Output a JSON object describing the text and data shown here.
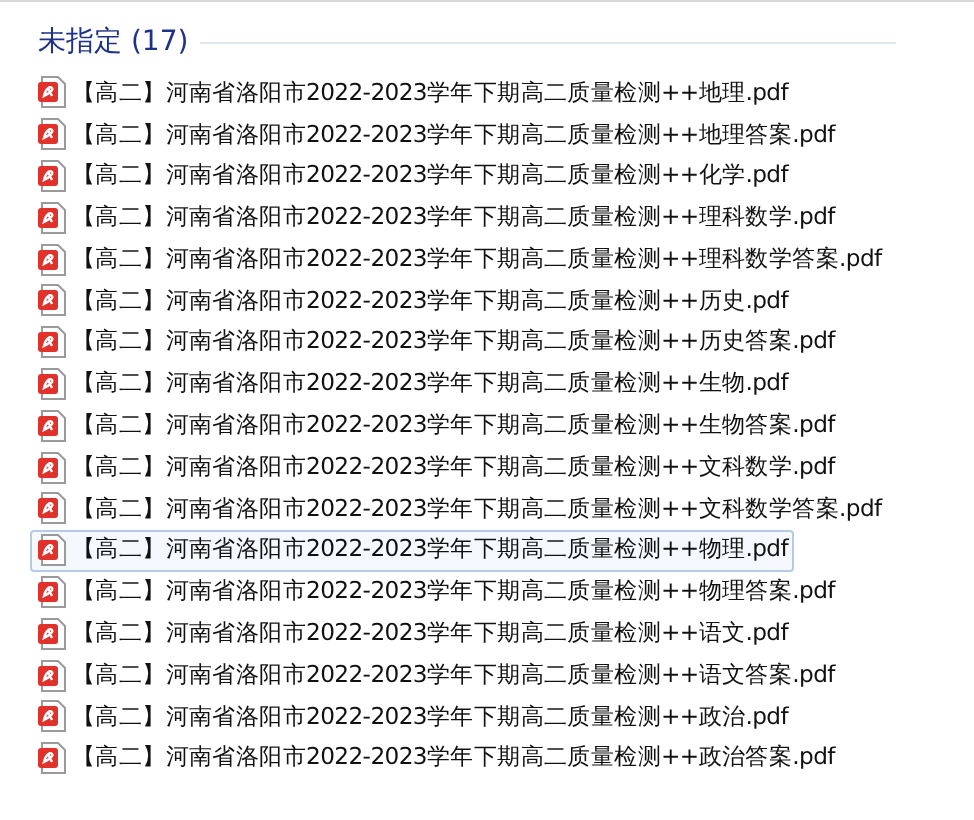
{
  "group": {
    "title": "未指定 (17)"
  },
  "files": [
    {
      "name": "【高二】河南省洛阳市2022-2023学年下期高二质量检测++地理.pdf",
      "selected": false
    },
    {
      "name": "【高二】河南省洛阳市2022-2023学年下期高二质量检测++地理答案.pdf",
      "selected": false
    },
    {
      "name": "【高二】河南省洛阳市2022-2023学年下期高二质量检测++化学.pdf",
      "selected": false
    },
    {
      "name": "【高二】河南省洛阳市2022-2023学年下期高二质量检测++理科数学.pdf",
      "selected": false
    },
    {
      "name": "【高二】河南省洛阳市2022-2023学年下期高二质量检测++理科数学答案.pdf",
      "selected": false
    },
    {
      "name": "【高二】河南省洛阳市2022-2023学年下期高二质量检测++历史.pdf",
      "selected": false
    },
    {
      "name": "【高二】河南省洛阳市2022-2023学年下期高二质量检测++历史答案.pdf",
      "selected": false
    },
    {
      "name": "【高二】河南省洛阳市2022-2023学年下期高二质量检测++生物.pdf",
      "selected": false
    },
    {
      "name": "【高二】河南省洛阳市2022-2023学年下期高二质量检测++生物答案.pdf",
      "selected": false
    },
    {
      "name": "【高二】河南省洛阳市2022-2023学年下期高二质量检测++文科数学.pdf",
      "selected": false
    },
    {
      "name": "【高二】河南省洛阳市2022-2023学年下期高二质量检测++文科数学答案.pdf",
      "selected": false
    },
    {
      "name": "【高二】河南省洛阳市2022-2023学年下期高二质量检测++物理.pdf",
      "selected": true
    },
    {
      "name": "【高二】河南省洛阳市2022-2023学年下期高二质量检测++物理答案.pdf",
      "selected": false
    },
    {
      "name": "【高二】河南省洛阳市2022-2023学年下期高二质量检测++语文.pdf",
      "selected": false
    },
    {
      "name": "【高二】河南省洛阳市2022-2023学年下期高二质量检测++语文答案.pdf",
      "selected": false
    },
    {
      "name": "【高二】河南省洛阳市2022-2023学年下期高二质量检测++政治.pdf",
      "selected": false
    },
    {
      "name": "【高二】河南省洛阳市2022-2023学年下期高二质量检测++政治答案.pdf",
      "selected": false
    }
  ]
}
